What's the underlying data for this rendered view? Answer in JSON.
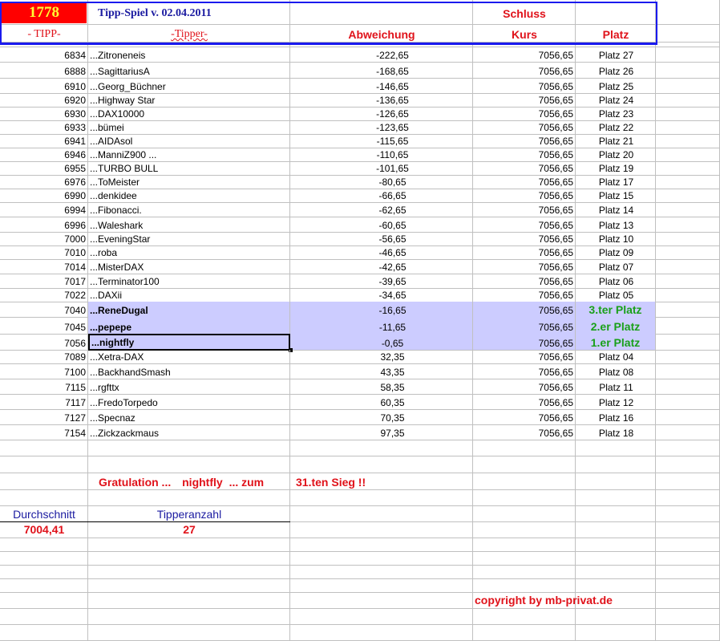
{
  "header": {
    "count": "1778",
    "title": "Tipp-Spiel v. 02.04.2011",
    "schluss": "Schluss",
    "col_tipp": "- TIPP-",
    "col_tipper": "-Tipper-",
    "col_abweichung": "Abweichung",
    "col_kurs": "Kurs",
    "col_platz": "Platz"
  },
  "rows": [
    {
      "tipp": "6834",
      "name": "...Zitroneneis",
      "abw": "-222,65",
      "kurs": "7056,65",
      "platz": "Platz 27"
    },
    {
      "tipp": "6888",
      "name": "...SagittariusA",
      "abw": "-168,65",
      "kurs": "7056,65",
      "platz": "Platz 26"
    },
    {
      "tipp": "6910",
      "name": "...Georg_Büchner",
      "abw": "-146,65",
      "kurs": "7056,65",
      "platz": "Platz 25"
    },
    {
      "tipp": "6920",
      "name": "...Highway Star",
      "abw": "-136,65",
      "kurs": "7056,65",
      "platz": "Platz 24"
    },
    {
      "tipp": "6930",
      "name": "...DAX10000",
      "abw": "-126,65",
      "kurs": "7056,65",
      "platz": "Platz 23"
    },
    {
      "tipp": "6933",
      "name": "...bümei",
      "abw": "-123,65",
      "kurs": "7056,65",
      "platz": "Platz 22"
    },
    {
      "tipp": "6941",
      "name": "...AIDAsol",
      "abw": "-115,65",
      "kurs": "7056,65",
      "platz": "Platz 21"
    },
    {
      "tipp": "6946",
      "name": "...ManniZ900 ...",
      "abw": "-110,65",
      "kurs": "7056,65",
      "platz": "Platz 20"
    },
    {
      "tipp": "6955",
      "name": "...TURBO BULL",
      "abw": "-101,65",
      "kurs": "7056,65",
      "platz": "Platz 19"
    },
    {
      "tipp": "6976",
      "name": "...ToMeister",
      "abw": "-80,65",
      "kurs": "7056,65",
      "platz": "Platz 17"
    },
    {
      "tipp": "6990",
      "name": "...denkidee",
      "abw": "-66,65",
      "kurs": "7056,65",
      "platz": "Platz 15"
    },
    {
      "tipp": "6994",
      "name": "...Fibonacci.",
      "abw": "-62,65",
      "kurs": "7056,65",
      "platz": "Platz 14"
    },
    {
      "tipp": "6996",
      "name": "...Waleshark",
      "abw": "-60,65",
      "kurs": "7056,65",
      "platz": "Platz 13"
    },
    {
      "tipp": "7000",
      "name": "...EveningStar",
      "abw": "-56,65",
      "kurs": "7056,65",
      "platz": "Platz 10"
    },
    {
      "tipp": "7010",
      "name": "...roba",
      "abw": "-46,65",
      "kurs": "7056,65",
      "platz": "Platz 09"
    },
    {
      "tipp": "7014",
      "name": "...MisterDAX",
      "abw": "-42,65",
      "kurs": "7056,65",
      "platz": "Platz 07"
    },
    {
      "tipp": "7017",
      "name": "...Terminator100",
      "abw": "-39,65",
      "kurs": "7056,65",
      "platz": "Platz 06"
    },
    {
      "tipp": "7022",
      "name": "...DAXii",
      "abw": "-34,65",
      "kurs": "7056,65",
      "platz": "Platz 05"
    },
    {
      "tipp": "7040",
      "name": "...ReneDugal",
      "abw": "-16,65",
      "kurs": "7056,65",
      "platz": "3.ter Platz",
      "winner": true
    },
    {
      "tipp": "7045",
      "name": "...pepepe",
      "abw": "-11,65",
      "kurs": "7056,65",
      "platz": "2.er Platz",
      "winner": true
    },
    {
      "tipp": "7056",
      "name": "...nightfly",
      "abw": "-0,65",
      "kurs": "7056,65",
      "platz": "1.er Platz",
      "winner": true,
      "selected": true
    },
    {
      "tipp": "7089",
      "name": "...Xetra-DAX",
      "abw": "32,35",
      "kurs": "7056,65",
      "platz": "Platz 04"
    },
    {
      "tipp": "7100",
      "name": "...BackhandSmash",
      "abw": "43,35",
      "kurs": "7056,65",
      "platz": "Platz 08"
    },
    {
      "tipp": "7115",
      "name": "...rgfttx",
      "abw": "58,35",
      "kurs": "7056,65",
      "platz": "Platz 11"
    },
    {
      "tipp": "7117",
      "name": "...FredoTorpedo",
      "abw": "60,35",
      "kurs": "7056,65",
      "platz": "Platz 12"
    },
    {
      "tipp": "7127",
      "name": "...Specnaz",
      "abw": "70,35",
      "kurs": "7056,65",
      "platz": "Platz 16"
    },
    {
      "tipp": "7154",
      "name": "...Zickzackmaus",
      "abw": "97,35",
      "kurs": "7056,65",
      "platz": "Platz 18"
    }
  ],
  "gratulation": {
    "part1": "Gratulation ...",
    "winner": "nightfly",
    "part2": "... zum",
    "part3": "31.ten Sieg !!"
  },
  "stats": {
    "avg_label": "Durchschnitt",
    "avg_value": "7004,41",
    "count_label": "Tipperanzahl",
    "count_value": "27"
  },
  "copyright": "copyright by mb-privat.de",
  "colors": {
    "accent_red": "#e0121a",
    "header_blue": "#1a1aa0",
    "highlight": "#ccccff",
    "winner_green": "#1aa01a"
  }
}
